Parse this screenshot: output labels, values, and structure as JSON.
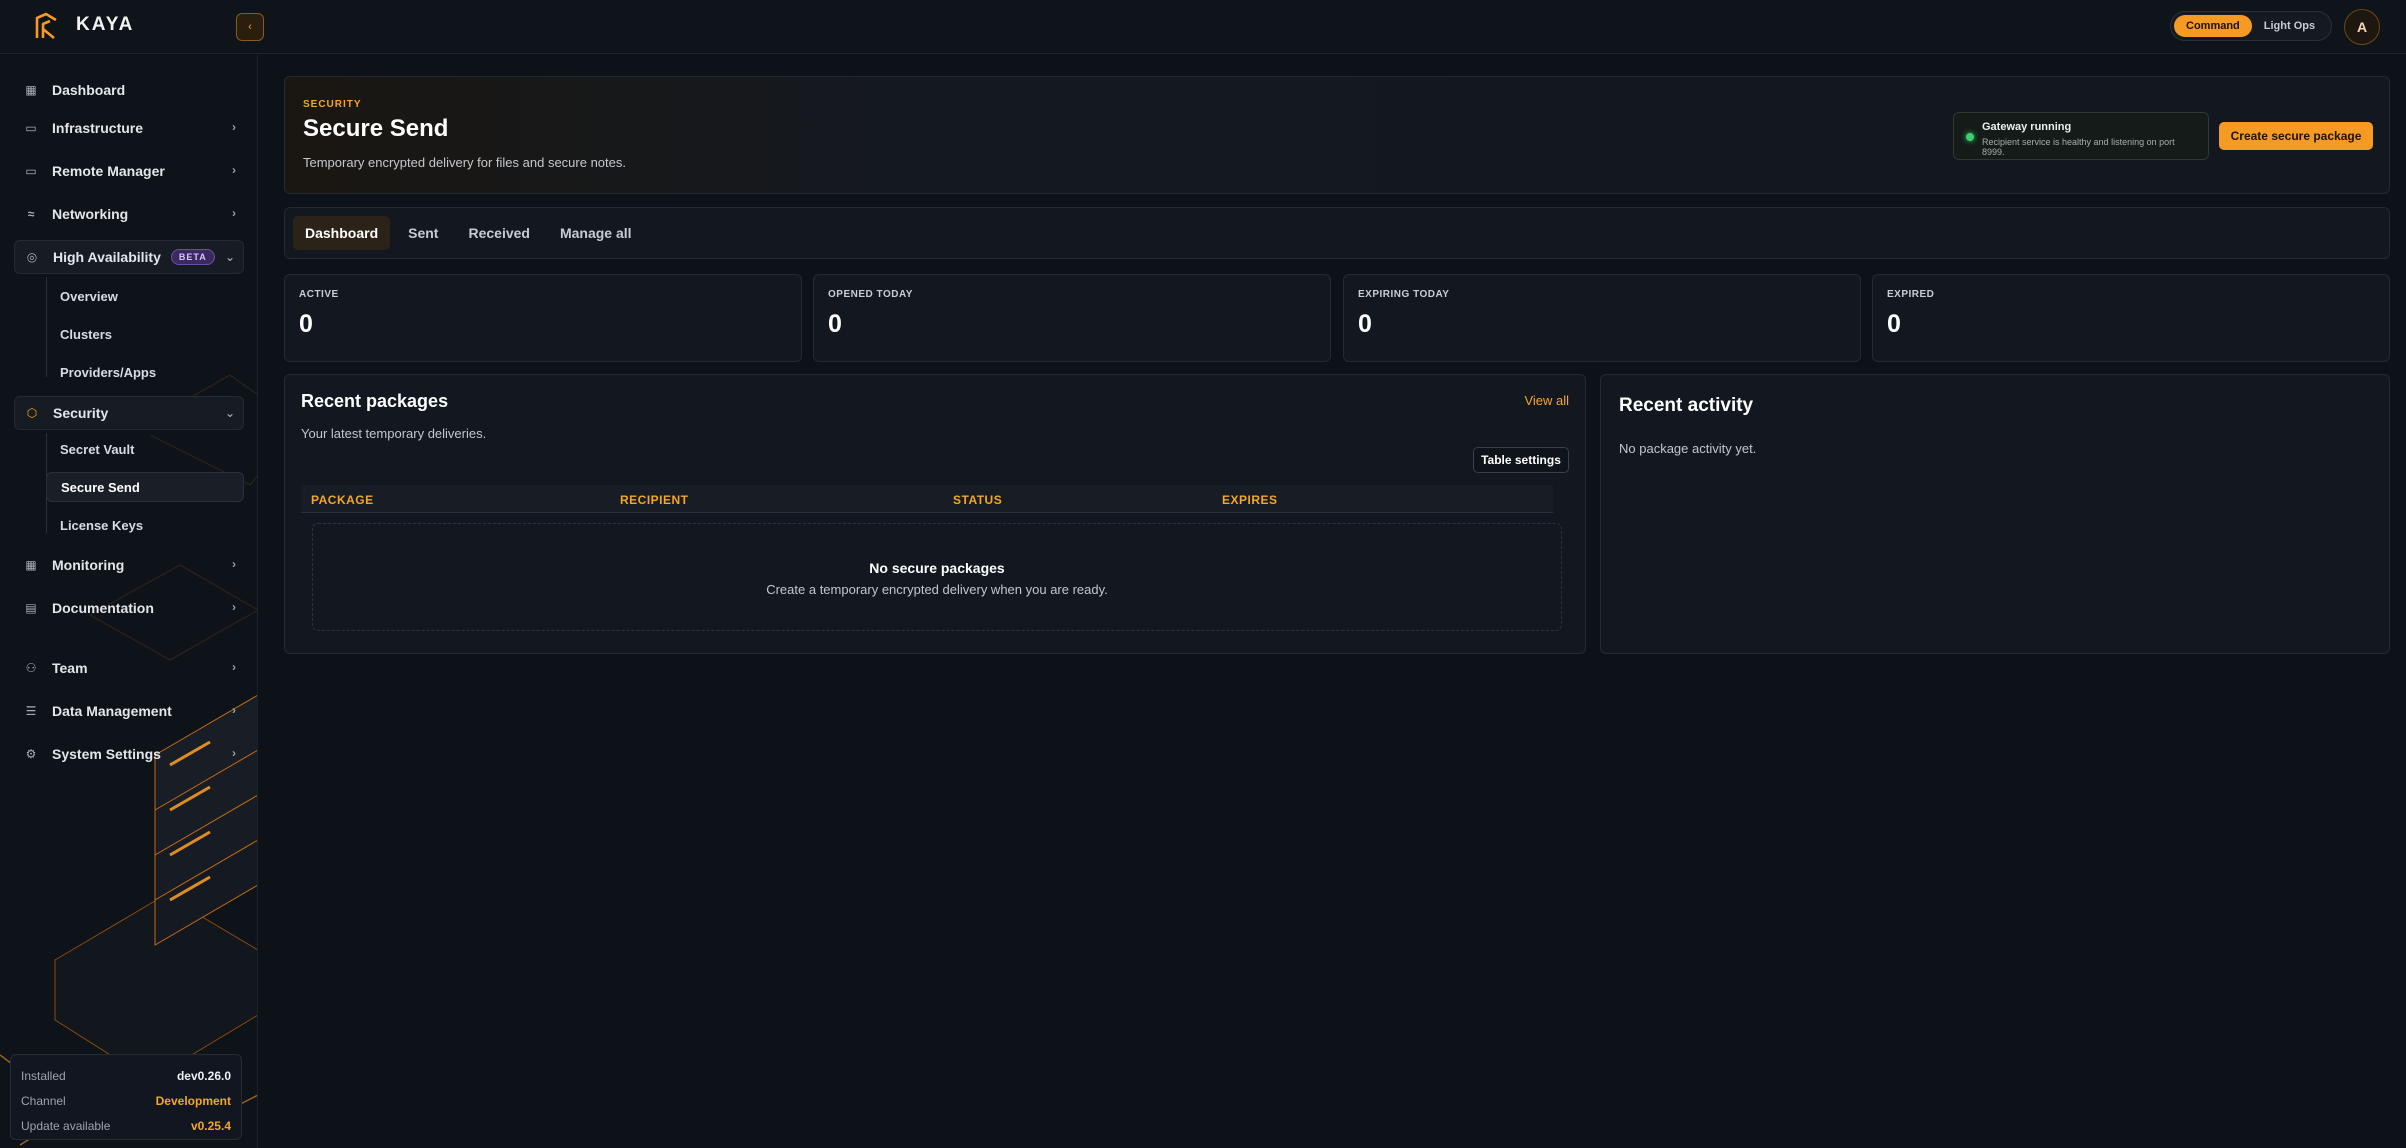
{
  "brand": {
    "name": "KAYA",
    "collapse_icon": "chevron-left-icon"
  },
  "header": {
    "mode_options": [
      {
        "label": "Command",
        "active": true
      },
      {
        "label": "Light Ops",
        "active": false
      }
    ],
    "avatar_initial": "A"
  },
  "sidebar": {
    "items": [
      {
        "label": "Dashboard",
        "icon": "grid-icon"
      },
      {
        "label": "Infrastructure",
        "icon": "monitor-icon"
      },
      {
        "label": "Remote Manager",
        "icon": "screen-icon"
      },
      {
        "label": "Networking",
        "icon": "wifi-icon"
      },
      {
        "label": "High Availability",
        "icon": "globe-icon",
        "badge": "BETA"
      },
      {
        "label": "Security",
        "icon": "shield-icon"
      },
      {
        "label": "Monitoring",
        "icon": "dashboard-icon"
      },
      {
        "label": "Documentation",
        "icon": "document-icon"
      },
      {
        "label": "Team",
        "icon": "users-icon"
      },
      {
        "label": "Data Management",
        "icon": "database-icon"
      },
      {
        "label": "System Settings",
        "icon": "gear-icon"
      }
    ],
    "ha_sub": [
      "Overview",
      "Clusters",
      "Providers/Apps"
    ],
    "security_sub": [
      "Secret Vault",
      "Secure Send",
      "License Keys"
    ],
    "active_sub": "Secure Send"
  },
  "version": {
    "installed_label": "Installed",
    "installed_value": "dev0.26.0",
    "channel_label": "Channel",
    "channel_value": "Development",
    "update_label": "Update available",
    "update_value": "v0.25.4"
  },
  "hero": {
    "eyebrow": "SECURITY",
    "title": "Secure Send",
    "description": "Temporary encrypted delivery for files and secure notes.",
    "gateway_title": "Gateway running",
    "gateway_sub": "Recipient service is healthy and listening on port 8999.",
    "create_label": "Create secure package"
  },
  "tabs": [
    {
      "label": "Dashboard",
      "active": true
    },
    {
      "label": "Sent",
      "active": false
    },
    {
      "label": "Received",
      "active": false
    },
    {
      "label": "Manage all",
      "active": false
    }
  ],
  "stats": [
    {
      "label": "ACTIVE",
      "value": "0"
    },
    {
      "label": "OPENED TODAY",
      "value": "0"
    },
    {
      "label": "EXPIRING TODAY",
      "value": "0"
    },
    {
      "label": "EXPIRED",
      "value": "0"
    }
  ],
  "packages": {
    "title": "Recent packages",
    "subtitle": "Your latest temporary deliveries.",
    "view_all": "View all",
    "table_settings": "Table settings",
    "columns": [
      "PACKAGE",
      "RECIPIENT",
      "STATUS",
      "EXPIRES"
    ],
    "empty_title": "No secure packages",
    "empty_sub": "Create a temporary encrypted delivery when you are ready."
  },
  "activity": {
    "title": "Recent activity",
    "empty": "No package activity yet."
  },
  "colors": {
    "accent": "#f59a23",
    "background": "#0d1118",
    "status_ok": "#3ccf6a"
  }
}
